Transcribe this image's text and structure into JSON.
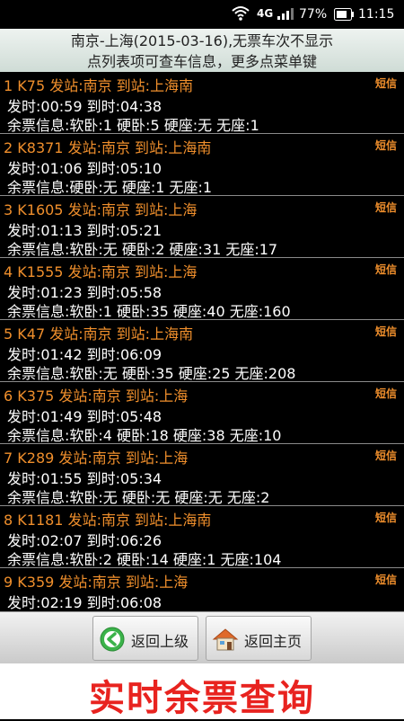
{
  "status": {
    "network": "4G",
    "battery_pct": "77%",
    "time": "11:15"
  },
  "header": {
    "line1": "南京-上海(2015-03-16),无票车次不显示",
    "line2": "点列表项可查车信息，更多点菜单键"
  },
  "sms_label": "短信",
  "trains": [
    {
      "title": "1 K75 发站:南京 到站:上海南",
      "times": "发时:00:59 到时:04:38",
      "tickets": "余票信息:软卧:1 硬卧:5 硬座:无 无座:1"
    },
    {
      "title": "2 K8371 发站:南京 到站:上海南",
      "times": "发时:01:06 到时:05:10",
      "tickets": "余票信息:硬卧:无 硬座:1 无座:1"
    },
    {
      "title": "3 K1605 发站:南京 到站:上海",
      "times": "发时:01:13 到时:05:21",
      "tickets": "余票信息:软卧:无 硬卧:2 硬座:31 无座:17"
    },
    {
      "title": "4 K1555 发站:南京 到站:上海",
      "times": "发时:01:23 到时:05:58",
      "tickets": "余票信息:软卧:1 硬卧:35 硬座:40 无座:160"
    },
    {
      "title": "5 K47 发站:南京 到站:上海南",
      "times": "发时:01:42 到时:06:09",
      "tickets": "余票信息:软卧:无 硬卧:35 硬座:25 无座:208"
    },
    {
      "title": "6 K375 发站:南京 到站:上海",
      "times": "发时:01:49 到时:05:48",
      "tickets": "余票信息:软卧:4 硬卧:18 硬座:38 无座:10"
    },
    {
      "title": "7 K289 发站:南京 到站:上海",
      "times": "发时:01:55 到时:05:34",
      "tickets": "余票信息:软卧:无 硬卧:无 硬座:无 无座:2"
    },
    {
      "title": "8 K1181 发站:南京 到站:上海南",
      "times": "发时:02:07 到时:06:26",
      "tickets": "余票信息:软卧:2 硬卧:14 硬座:1 无座:104"
    },
    {
      "title": "9 K359 发站:南京 到站:上海",
      "times": "发时:02:19 到时:06:08",
      "tickets": ""
    }
  ],
  "buttons": {
    "back": "返回上级",
    "home": "返回主页"
  },
  "banner": "实时余票查询",
  "colors": {
    "accent": "#f08f2c",
    "banner_text": "#e8231f",
    "back_icon": "#3bb34a"
  }
}
